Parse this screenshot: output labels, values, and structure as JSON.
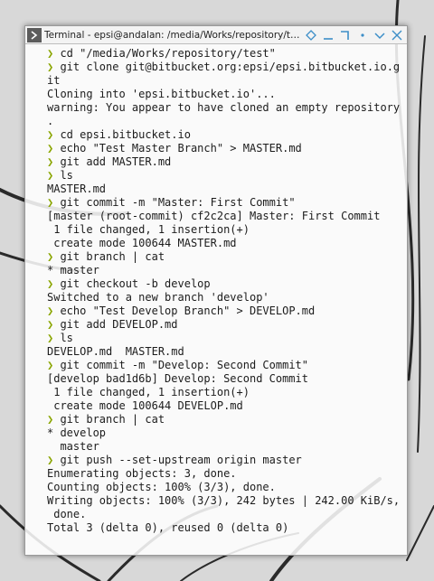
{
  "window": {
    "title": "Terminal - epsi@andalan: /media/Works/repository/test/ep...",
    "icons": [
      "terminal-icon",
      "diamond-icon",
      "minimize-icon",
      "maximize-icon",
      "dot-icon",
      "chevron-down-icon",
      "close-icon"
    ]
  },
  "colors": {
    "prompt": "#8aa500",
    "text": "#1c1c1c",
    "titlebar": "#f3f3f3",
    "accent": "#3c8ec8"
  },
  "terminal": {
    "prompt_symbol": "❯",
    "lines": [
      {
        "prompt": true,
        "text": " cd \"/media/Works/repository/test\""
      },
      {
        "prompt": true,
        "text": " git clone git@bitbucket.org:epsi/epsi.bitbucket.io.g"
      },
      {
        "prompt": false,
        "text": "it"
      },
      {
        "prompt": false,
        "text": "Cloning into 'epsi.bitbucket.io'..."
      },
      {
        "prompt": false,
        "text": "warning: You appear to have cloned an empty repository"
      },
      {
        "prompt": false,
        "text": "."
      },
      {
        "prompt": true,
        "text": " cd epsi.bitbucket.io"
      },
      {
        "prompt": true,
        "text": " echo \"Test Master Branch\" > MASTER.md"
      },
      {
        "prompt": true,
        "text": " git add MASTER.md"
      },
      {
        "prompt": true,
        "text": " ls"
      },
      {
        "prompt": false,
        "text": "MASTER.md"
      },
      {
        "prompt": true,
        "text": " git commit -m \"Master: First Commit\""
      },
      {
        "prompt": false,
        "text": "[master (root-commit) cf2c2ca] Master: First Commit"
      },
      {
        "prompt": false,
        "text": " 1 file changed, 1 insertion(+)"
      },
      {
        "prompt": false,
        "text": " create mode 100644 MASTER.md"
      },
      {
        "prompt": true,
        "text": " git branch | cat"
      },
      {
        "prompt": false,
        "text": "* master"
      },
      {
        "prompt": true,
        "text": " git checkout -b develop"
      },
      {
        "prompt": false,
        "text": "Switched to a new branch 'develop'"
      },
      {
        "prompt": true,
        "text": " echo \"Test Develop Branch\" > DEVELOP.md"
      },
      {
        "prompt": true,
        "text": " git add DEVELOP.md"
      },
      {
        "prompt": true,
        "text": " ls"
      },
      {
        "prompt": false,
        "text": "DEVELOP.md  MASTER.md"
      },
      {
        "prompt": true,
        "text": " git commit -m \"Develop: Second Commit\""
      },
      {
        "prompt": false,
        "text": "[develop bad1d6b] Develop: Second Commit"
      },
      {
        "prompt": false,
        "text": " 1 file changed, 1 insertion(+)"
      },
      {
        "prompt": false,
        "text": " create mode 100644 DEVELOP.md"
      },
      {
        "prompt": true,
        "text": " git branch | cat"
      },
      {
        "prompt": false,
        "text": "* develop"
      },
      {
        "prompt": false,
        "text": "  master"
      },
      {
        "prompt": true,
        "text": " git push --set-upstream origin master"
      },
      {
        "prompt": false,
        "text": "Enumerating objects: 3, done."
      },
      {
        "prompt": false,
        "text": "Counting objects: 100% (3/3), done."
      },
      {
        "prompt": false,
        "text": "Writing objects: 100% (3/3), 242 bytes | 242.00 KiB/s,"
      },
      {
        "prompt": false,
        "text": " done."
      },
      {
        "prompt": false,
        "text": "Total 3 (delta 0), reused 0 (delta 0)"
      }
    ]
  }
}
